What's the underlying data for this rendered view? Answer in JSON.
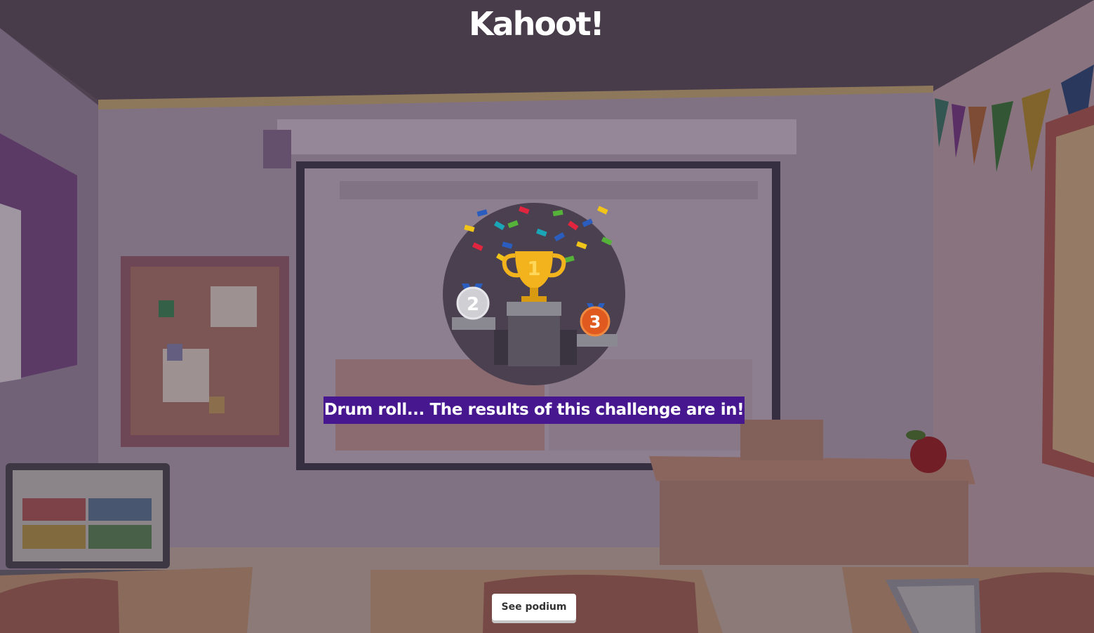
{
  "header": {
    "logo_text": "Kahoot!"
  },
  "podium": {
    "places": [
      "2",
      "1",
      "3"
    ],
    "colors": {
      "gold": "#f2b31c",
      "silver": "#cfcfd4",
      "bronze": "#e0591f",
      "ribbon": "#2a5dbd"
    }
  },
  "banner": {
    "text": "Drum roll... The results of this challenge are in!",
    "color": "#46178f"
  },
  "actions": {
    "see_podium_label": "See podium"
  }
}
